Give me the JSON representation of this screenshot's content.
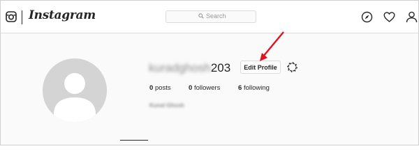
{
  "header": {
    "wordmark": "Instagram",
    "search": {
      "placeholder": "Search"
    },
    "icons": [
      "instagram-glyph-icon",
      "compass-icon",
      "heart-icon",
      "person-icon"
    ]
  },
  "profile": {
    "username_blurred": "kuradghosh",
    "username_suffix": "203",
    "edit_profile_label": "Edit Profile",
    "stats": {
      "posts_count": "0",
      "posts_label": "posts",
      "followers_count": "0",
      "followers_label": "followers",
      "following_count": "6",
      "following_label": "following"
    },
    "full_name": "Kunal Ghosh"
  },
  "colors": {
    "annotation_arrow": "#e3111b",
    "text": "#262626",
    "border": "#dbdbdb"
  }
}
